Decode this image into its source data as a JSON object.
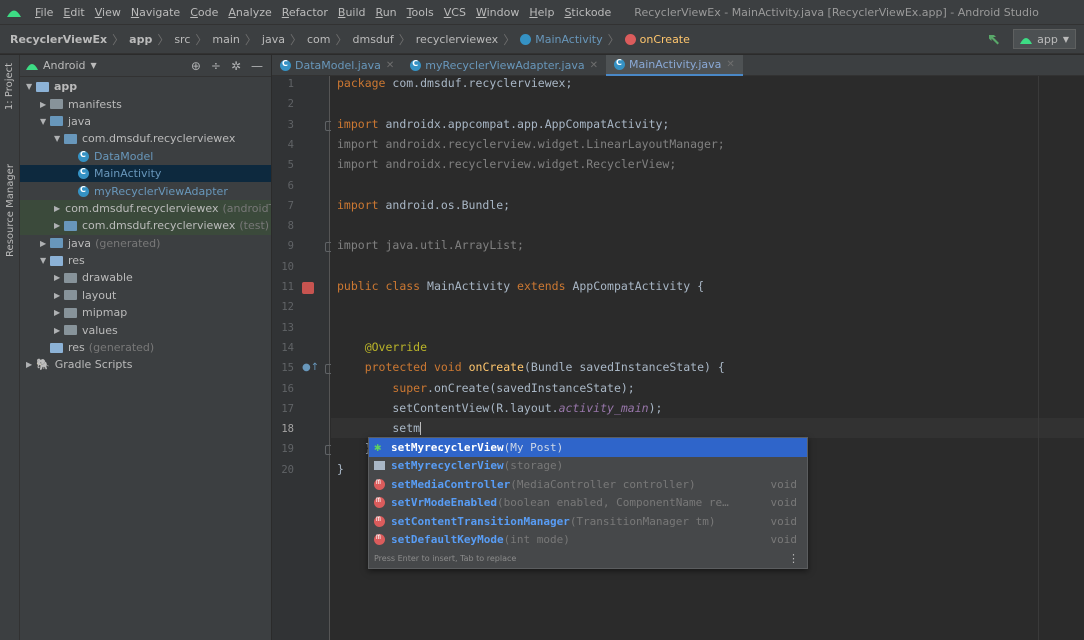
{
  "menubar": {
    "items": [
      "File",
      "Edit",
      "View",
      "Navigate",
      "Code",
      "Analyze",
      "Refactor",
      "Build",
      "Run",
      "Tools",
      "VCS",
      "Window",
      "Help",
      "Stickode"
    ],
    "window_title": "RecyclerViewEx - MainActivity.java [RecyclerViewEx.app] - Android Studio"
  },
  "breadcrumb": {
    "items": [
      "RecyclerViewEx",
      "app",
      "src",
      "main",
      "java",
      "com",
      "dmsduf",
      "recyclerviewex",
      "MainActivity",
      "onCreate"
    ],
    "run_config": "app"
  },
  "toolstrip": {
    "project_tab": "1: Project",
    "resource_tab": "Resource Manager"
  },
  "project": {
    "view_mode": "Android",
    "tree": [
      {
        "label": "app",
        "depth": 0,
        "expanded": true,
        "kind": "module"
      },
      {
        "label": "manifests",
        "depth": 1,
        "expanded": false,
        "kind": "folder"
      },
      {
        "label": "java",
        "depth": 1,
        "expanded": true,
        "kind": "folder-blue"
      },
      {
        "label": "com.dmsduf.recyclerviewex",
        "depth": 2,
        "expanded": true,
        "kind": "package"
      },
      {
        "label": "DataModel",
        "depth": 3,
        "kind": "class"
      },
      {
        "label": "MainActivity",
        "depth": 3,
        "kind": "class",
        "selected": true
      },
      {
        "label": "myRecyclerViewAdapter",
        "depth": 3,
        "kind": "class"
      },
      {
        "label": "com.dmsduf.recyclerviewex",
        "suffix": "(androidTes",
        "depth": 2,
        "expanded": false,
        "kind": "package",
        "green": true
      },
      {
        "label": "com.dmsduf.recyclerviewex",
        "suffix": "(test)",
        "depth": 2,
        "expanded": false,
        "kind": "package",
        "green": true
      },
      {
        "label": "java",
        "suffix": "(generated)",
        "depth": 1,
        "expanded": false,
        "kind": "folder-blue"
      },
      {
        "label": "res",
        "depth": 1,
        "expanded": true,
        "kind": "folder-src"
      },
      {
        "label": "drawable",
        "depth": 2,
        "expanded": false,
        "kind": "folder"
      },
      {
        "label": "layout",
        "depth": 2,
        "expanded": false,
        "kind": "folder"
      },
      {
        "label": "mipmap",
        "depth": 2,
        "expanded": false,
        "kind": "folder"
      },
      {
        "label": "values",
        "depth": 2,
        "expanded": false,
        "kind": "folder"
      },
      {
        "label": "res",
        "suffix": "(generated)",
        "depth": 1,
        "kind": "folder-src"
      },
      {
        "label": "Gradle Scripts",
        "depth": 0,
        "expanded": false,
        "kind": "gradle"
      }
    ]
  },
  "tabs": [
    {
      "label": "DataModel.java",
      "active": false
    },
    {
      "label": "myRecyclerViewAdapter.java",
      "active": false
    },
    {
      "label": "MainActivity.java",
      "active": true
    }
  ],
  "editor": {
    "current_line": 18,
    "lines": [
      "package com.dmsduf.recyclerviewex;",
      "",
      "import androidx.appcompat.app.AppCompatActivity;",
      "import androidx.recyclerview.widget.LinearLayoutManager;",
      "import androidx.recyclerview.widget.RecyclerView;",
      "",
      "import android.os.Bundle;",
      "",
      "import java.util.ArrayList;",
      "",
      "public class MainActivity extends AppCompatActivity {",
      "",
      "",
      "    @Override",
      "    protected void onCreate(Bundle savedInstanceState) {",
      "        super.onCreate(savedInstanceState);",
      "        setContentView(R.layout.activity_main);",
      "        setm",
      "    }",
      "}"
    ]
  },
  "completion": {
    "items": [
      {
        "name": "setMyrecyclerView",
        "params": "(My Post)",
        "ret": "",
        "icon": "star-icon"
      },
      {
        "name": "setMyrecyclerView",
        "params": "(storage)",
        "ret": "",
        "icon": "template-icon"
      },
      {
        "name": "setMediaController",
        "params": "(MediaController controller)",
        "ret": "void",
        "icon": "method-icon"
      },
      {
        "name": "setVrModeEnabled",
        "params": "(boolean enabled, ComponentName re…",
        "ret": "void",
        "icon": "method-icon"
      },
      {
        "name": "setContentTransitionManager",
        "params": "(TransitionManager tm)",
        "ret": "void",
        "icon": "method-icon"
      },
      {
        "name": "setDefaultKeyMode",
        "params": "(int mode)",
        "ret": "void",
        "icon": "method-icon"
      }
    ],
    "footer": "Press Enter to insert, Tab to replace",
    "more": "⋮"
  },
  "colors": {
    "background": "#2b2b2b",
    "panel": "#3c3f41",
    "selection": "#0d293e",
    "popup_selection": "#2f65ca"
  }
}
